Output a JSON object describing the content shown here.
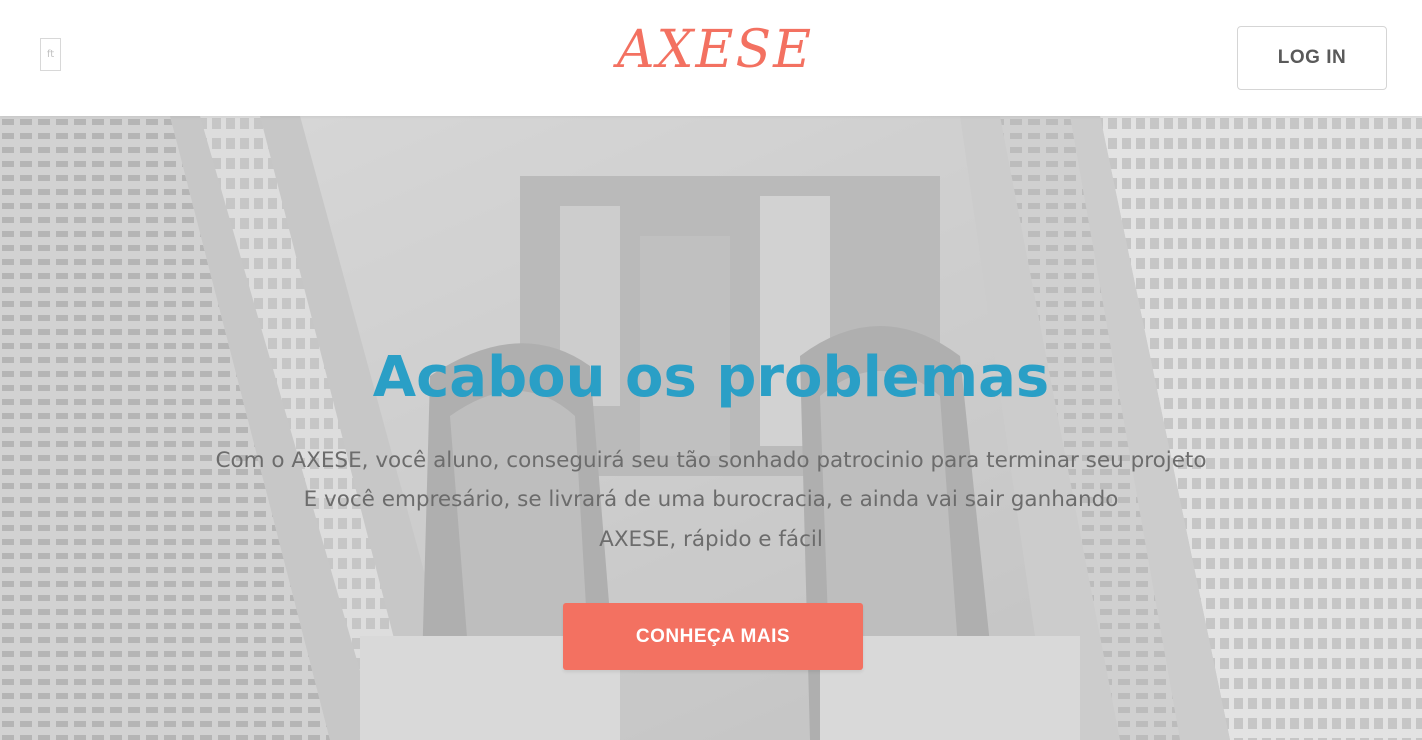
{
  "navbar": {
    "menu_icon_alt": "ft",
    "logo_text": "AXESE",
    "login_label": "LOG IN"
  },
  "hero": {
    "title": "Acabou os problemas",
    "lines": [
      "Com o AXESE, você aluno, conseguirá seu tão sonhado patrocinio para terminar seu projeto",
      "E você empresário, se livrará de uma burocracia, e ainda vai sair ganhando",
      "AXESE, rápido e fácil"
    ],
    "cta_label": "CONHEÇA MAIS",
    "background_image": "city-buildings-sneakers-photo"
  },
  "colors": {
    "brand": "#f37161",
    "title": "#2a9fc6",
    "body_text": "#6c6c6c"
  }
}
